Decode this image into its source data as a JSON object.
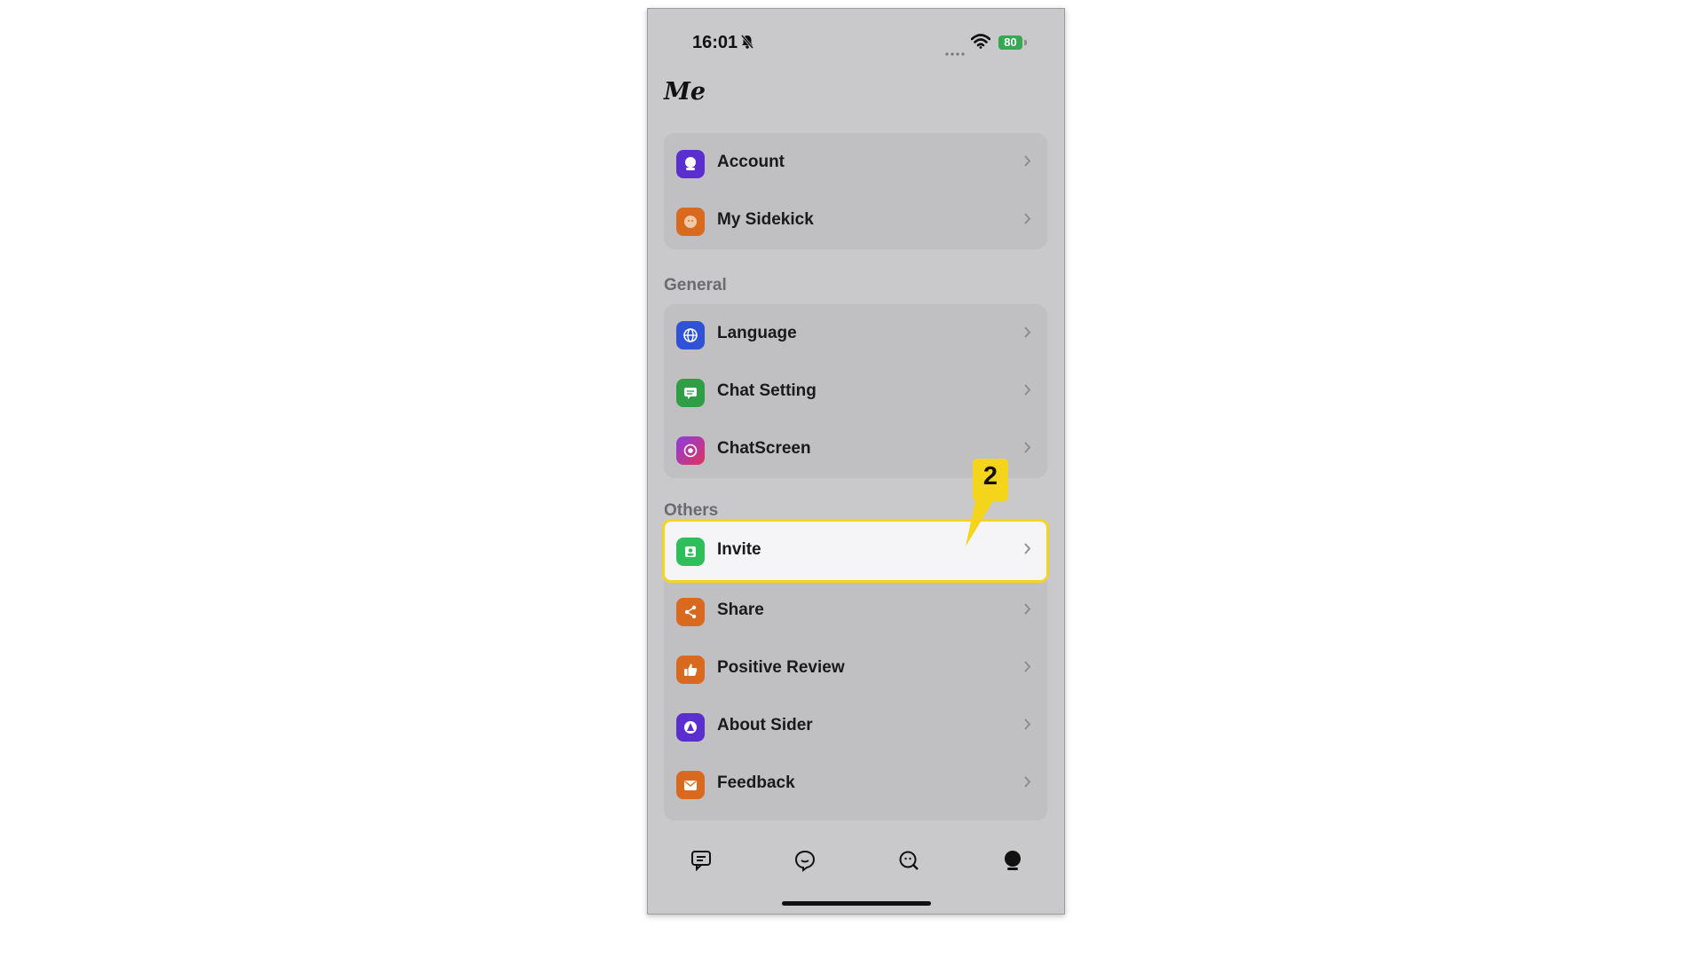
{
  "status_bar": {
    "time": "16:01",
    "battery": "80"
  },
  "page": {
    "title": "Me"
  },
  "top_group": [
    {
      "label": "Account",
      "icon": "account-icon",
      "color": "#5b2fcf"
    },
    {
      "label": "My Sidekick",
      "icon": "sidekick-icon",
      "color": "#d9691f"
    }
  ],
  "general": {
    "heading": "General",
    "items": [
      {
        "label": "Language",
        "icon": "globe-icon",
        "color": "#2f52d6"
      },
      {
        "label": "Chat Setting",
        "icon": "chat-setting-icon",
        "color": "#2f9e44"
      },
      {
        "label": "ChatScreen",
        "icon": "chatscreen-icon",
        "color": "#c2318c"
      }
    ]
  },
  "others": {
    "heading": "Others",
    "items": [
      {
        "label": "Invite",
        "icon": "invite-icon",
        "color": "#2fbf5a",
        "highlighted": true
      },
      {
        "label": "Share",
        "icon": "share-icon",
        "color": "#d9691f"
      },
      {
        "label": "Positive Review",
        "icon": "thumbs-up-icon",
        "color": "#d9691f"
      },
      {
        "label": "About Sider",
        "icon": "about-icon",
        "color": "#5b2fcf"
      },
      {
        "label": "Feedback",
        "icon": "feedback-icon",
        "color": "#d9691f"
      }
    ]
  },
  "callout": {
    "number": "2",
    "color": "#f5d51c"
  },
  "tabbar": [
    "chat-tab-icon",
    "sidekick-tab-icon",
    "search-tab-icon",
    "me-tab-icon"
  ]
}
